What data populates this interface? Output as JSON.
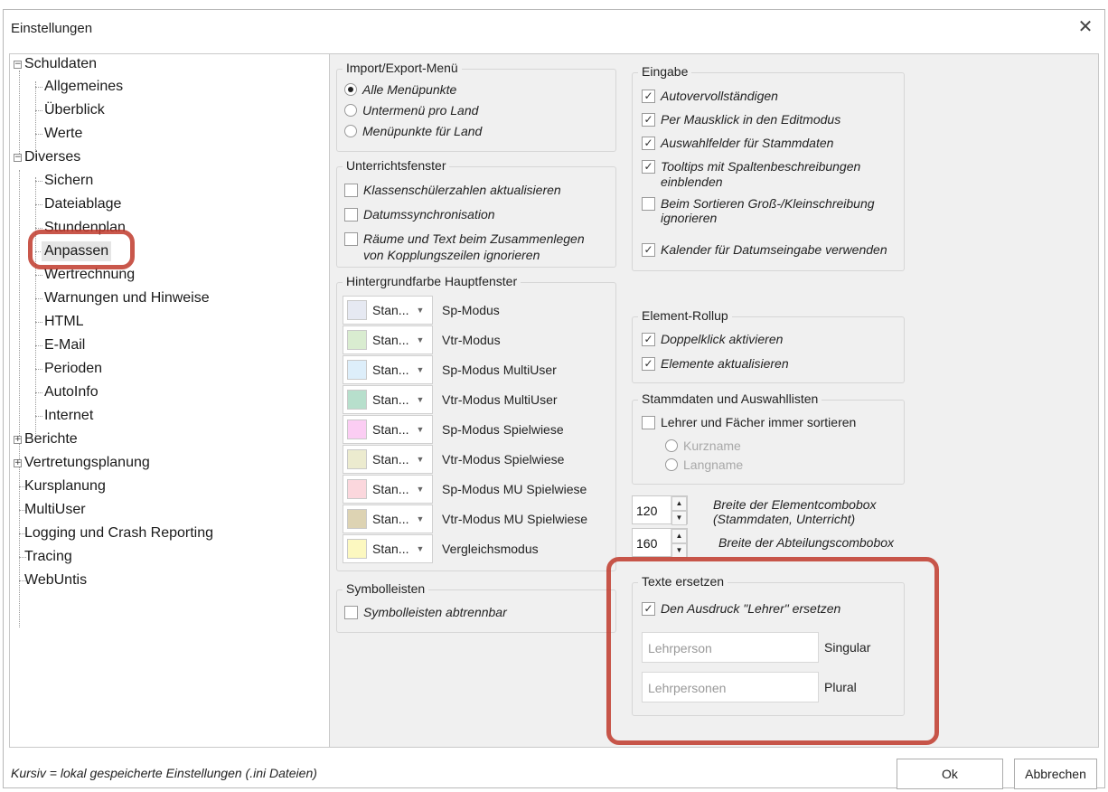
{
  "window": {
    "title": "Einstellungen"
  },
  "tree": {
    "nodes": [
      {
        "label": "Schuldaten",
        "expander": "−"
      },
      {
        "label": "Allgemeines"
      },
      {
        "label": "Überblick"
      },
      {
        "label": "Werte"
      },
      {
        "label": "Diverses",
        "expander": "−"
      },
      {
        "label": "Sichern"
      },
      {
        "label": "Dateiablage"
      },
      {
        "label": "Stundenplan"
      },
      {
        "label": "Anpassen"
      },
      {
        "label": "Wertrechnung"
      },
      {
        "label": "Warnungen und Hinweise"
      },
      {
        "label": "HTML"
      },
      {
        "label": "E-Mail"
      },
      {
        "label": "Perioden"
      },
      {
        "label": "AutoInfo"
      },
      {
        "label": "Internet"
      },
      {
        "label": "Berichte",
        "expander": "+"
      },
      {
        "label": "Vertretungsplanung",
        "expander": "+"
      },
      {
        "label": "Kursplanung"
      },
      {
        "label": "MultiUser"
      },
      {
        "label": "Logging und Crash Reporting"
      },
      {
        "label": "Tracing"
      },
      {
        "label": "WebUntis"
      }
    ]
  },
  "import_export": {
    "title": "Import/Export-Menü",
    "options": [
      "Alle Menüpunkte",
      "Untermenü pro Land",
      "Menüpunkte für Land"
    ]
  },
  "unterricht": {
    "title": "Unterrichtsfenster",
    "items": [
      "Klassenschülerzahlen aktualisieren",
      "Datumssynchronisation",
      "Räume und Text beim Zusammenlegen",
      "von Kopplungszeilen ignorieren"
    ]
  },
  "hintergrund": {
    "title": "Hintergrundfarbe Hauptfenster",
    "rows": [
      {
        "value": "Stan...",
        "label": "Sp-Modus",
        "color": "#e6e9f2"
      },
      {
        "value": "Stan...",
        "label": "Vtr-Modus",
        "color": "#d9ecd0"
      },
      {
        "value": "Stan...",
        "label": "Sp-Modus MultiUser",
        "color": "#ddeefa"
      },
      {
        "value": "Stan...",
        "label": "Vtr-Modus MultiUser",
        "color": "#b7dfcc"
      },
      {
        "value": "Stan...",
        "label": "Sp-Modus Spielwiese",
        "color": "#fbcdf3"
      },
      {
        "value": "Stan...",
        "label": "Vtr-Modus Spielwiese",
        "color": "#ecebcf"
      },
      {
        "value": "Stan...",
        "label": "Sp-Modus MU Spielwiese",
        "color": "#fbd7dd"
      },
      {
        "value": "Stan...",
        "label": "Vtr-Modus MU Spielwiese",
        "color": "#ddd3b3"
      },
      {
        "value": "Stan...",
        "label": "Vergleichsmodus",
        "color": "#fcf8c0"
      }
    ]
  },
  "symbolleisten": {
    "title": "Symbolleisten",
    "item": "Symbolleisten abtrennbar"
  },
  "eingabe": {
    "title": "Eingabe",
    "items": [
      "Autovervollständigen",
      "Per Mausklick in den Editmodus",
      "Auswahlfelder für Stammdaten",
      "Tooltips mit Spaltenbeschreibungen",
      "einblenden",
      "Beim Sortieren Groß-/Kleinschreibung",
      "ignorieren",
      "Kalender für Datumseingabe verwenden"
    ]
  },
  "rollup": {
    "title": "Element-Rollup",
    "items": [
      "Doppelklick aktivieren",
      "Elemente aktualisieren"
    ]
  },
  "stammdaten": {
    "title": "Stammdaten und Auswahllisten",
    "checkbox": "Lehrer und Fächer immer sortieren",
    "radios": [
      "Kurzname",
      "Langname"
    ]
  },
  "spinners": [
    {
      "value": "120",
      "line1": "Breite der Elementcombobox",
      "line2": "(Stammdaten, Unterricht)"
    },
    {
      "value": "160",
      "line1": "Breite der Abteilungscombobox",
      "line2": ""
    }
  ],
  "texte": {
    "title": "Texte ersetzen",
    "checkbox": "Den Ausdruck \"Lehrer\" ersetzen",
    "singular_placeholder": "Lehrperson",
    "singular_label": "Singular",
    "plural_placeholder": "Lehrpersonen",
    "plural_label": "Plural"
  },
  "footer": {
    "note": "Kursiv = lokal gespeicherte Einstellungen (.ini Dateien)",
    "ok": "Ok",
    "cancel": "Abbrechen"
  },
  "colors": {
    "highlight": "#c0392b",
    "panel_bg": "#f0f0f0"
  }
}
